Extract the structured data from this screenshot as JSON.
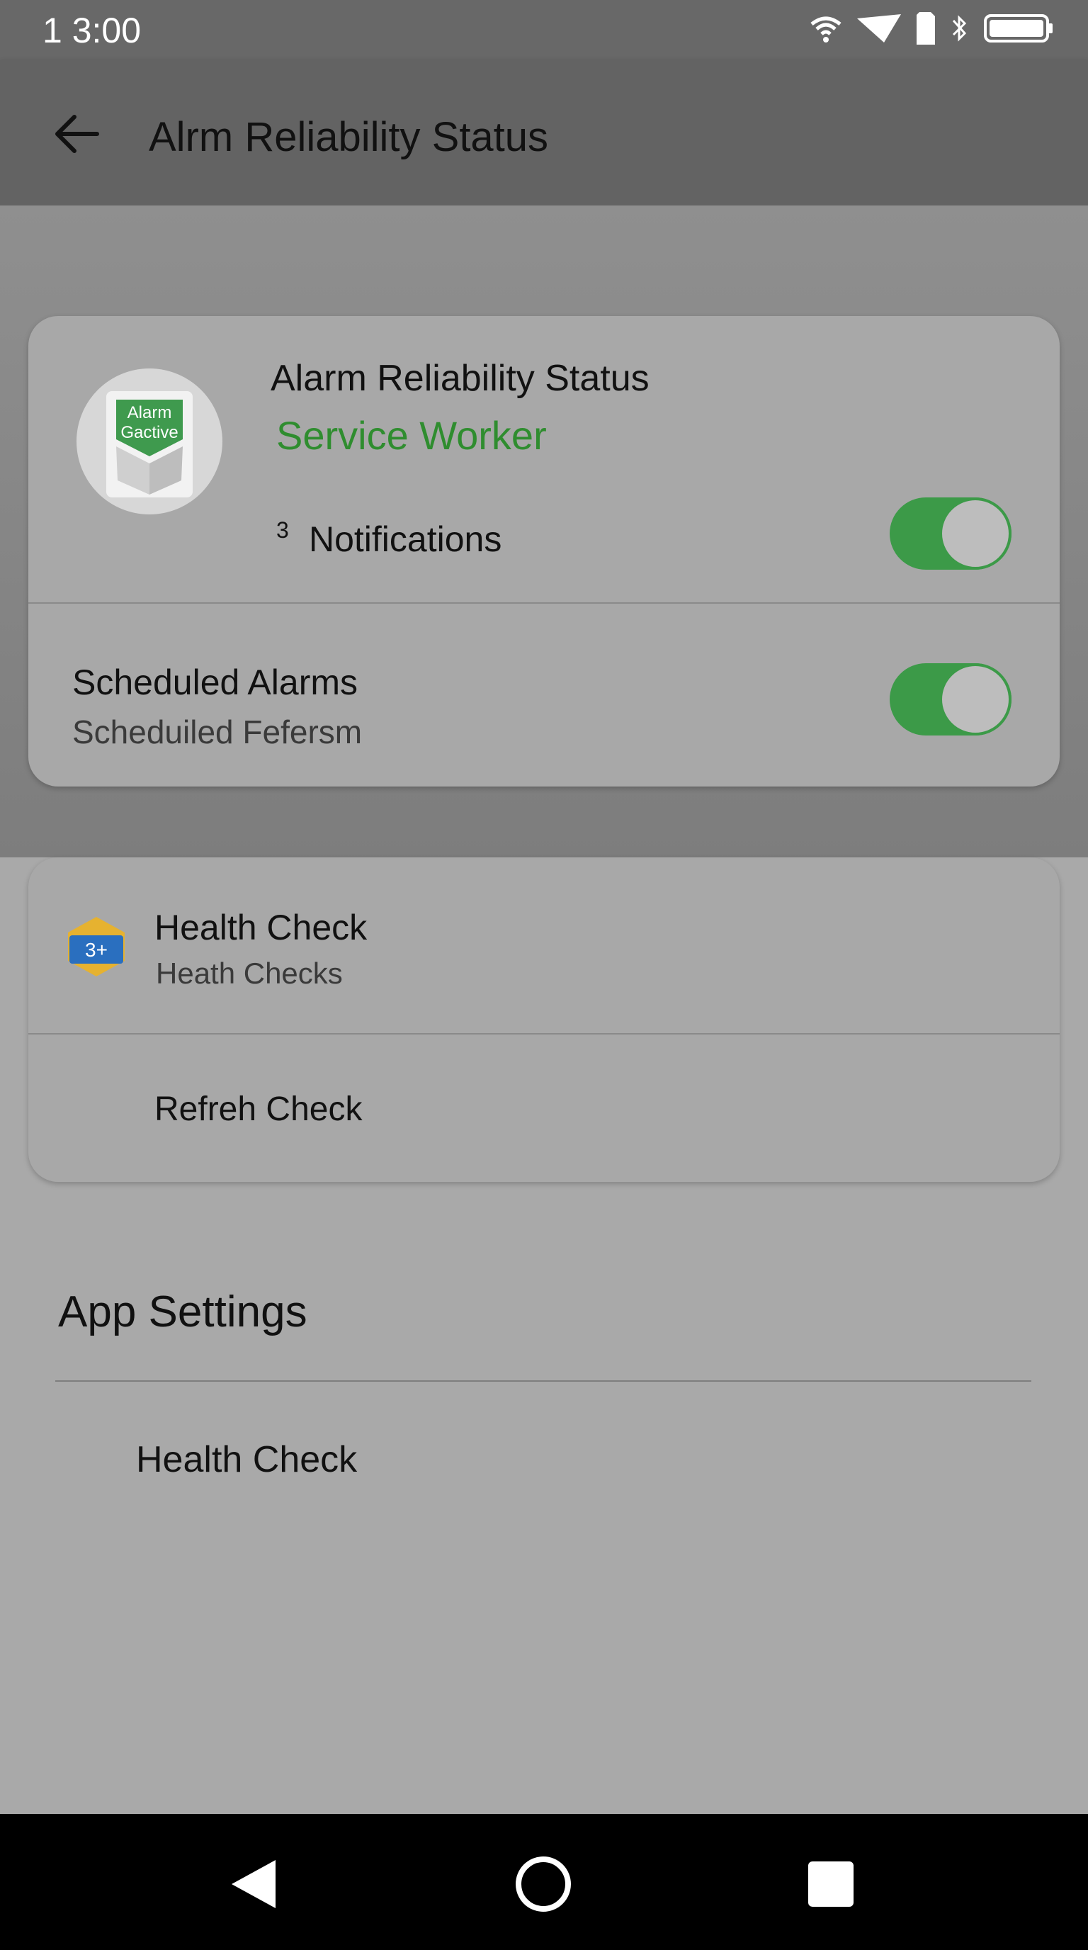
{
  "status_bar": {
    "time": "1 3:00",
    "icons": [
      "wifi-icon",
      "signal-icon",
      "sim-icon",
      "bluetooth-icon",
      "battery-icon"
    ]
  },
  "app_bar": {
    "title": "Alrm Reliability Status",
    "back_icon": "arrow-left-icon"
  },
  "status_card": {
    "logo_text_line1": "Alarm",
    "logo_text_line2": "Gactive",
    "title": "Alarm Reliability Status",
    "subtitle": "Service Worker",
    "notification_count": "3",
    "notifications_label": "Notifications",
    "notifications_enabled": true,
    "scheduled_title": "Scheduled Alarms",
    "scheduled_subtitle": "Scheduiled Fefersm",
    "scheduled_enabled": true
  },
  "health_card": {
    "icon_badge": "3+",
    "title": "Health Check",
    "subtitle": "Heath Checks",
    "refresh_label": "Refreh Check"
  },
  "app_settings": {
    "heading": "App Settings",
    "items": [
      {
        "label": "Health Check"
      }
    ]
  },
  "nav_bar": {
    "buttons": [
      "back-triangle-icon",
      "home-circle-icon",
      "recents-square-icon"
    ]
  },
  "colors": {
    "accent_green": "#3c9a48",
    "subtitle_green": "#2f8d2f",
    "nav_bar": "#000000"
  }
}
